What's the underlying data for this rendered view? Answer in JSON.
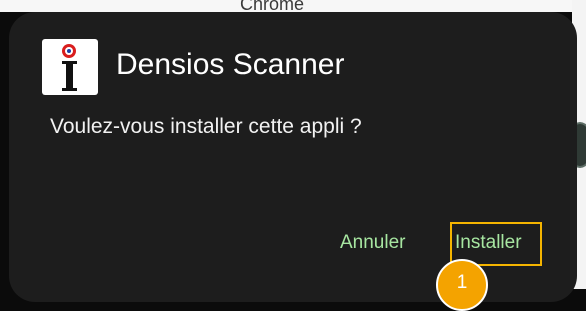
{
  "background": {
    "partial_title": "Chrome"
  },
  "dialog": {
    "app_name": "Densios Scanner",
    "prompt": "Voulez-vous installer cette appli ?",
    "cancel_label": "Annuler",
    "install_label": "Installer"
  },
  "annotation": {
    "step_number": "1",
    "highlight_color": "#f4b400"
  },
  "colors": {
    "dialog_bg": "#1d1d1d",
    "button_text": "#a7e6a1",
    "badge_bg": "#f4a300"
  },
  "icons": {
    "app_icon": "densios-app-icon"
  }
}
